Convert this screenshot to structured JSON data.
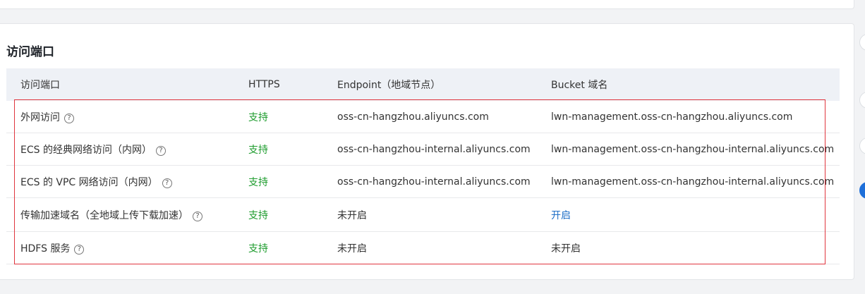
{
  "section_title": "访问端口",
  "columns": [
    "访问端口",
    "HTTPS",
    "Endpoint（地域节点）",
    "Bucket 域名"
  ],
  "rows": [
    {
      "port": "外网访问",
      "https": "支持",
      "endpoint": "oss-cn-hangzhou.aliyuncs.com",
      "bucket": "lwn-management.oss-cn-hangzhou.aliyuncs.com",
      "bucket_link": false
    },
    {
      "port": "ECS 的经典网络访问（内网）",
      "https": "支持",
      "endpoint": "oss-cn-hangzhou-internal.aliyuncs.com",
      "bucket": "lwn-management.oss-cn-hangzhou-internal.aliyuncs.com",
      "bucket_link": false
    },
    {
      "port": "ECS 的 VPC 网络访问（内网）",
      "https": "支持",
      "endpoint": "oss-cn-hangzhou-internal.aliyuncs.com",
      "bucket": "lwn-management.oss-cn-hangzhou-internal.aliyuncs.com",
      "bucket_link": false
    },
    {
      "port": "传输加速域名（全地域上传下载加速）",
      "https": "支持",
      "endpoint": "未开启",
      "bucket": "开启",
      "bucket_link": true
    },
    {
      "port": "HDFS 服务",
      "https": "支持",
      "endpoint": "未开启",
      "bucket": "未开启",
      "bucket_link": false
    }
  ],
  "help_glyph": "?",
  "colors": {
    "supported": "#1e9c2e",
    "link": "#1f6fc7",
    "highlight_border": "#e0363f"
  }
}
